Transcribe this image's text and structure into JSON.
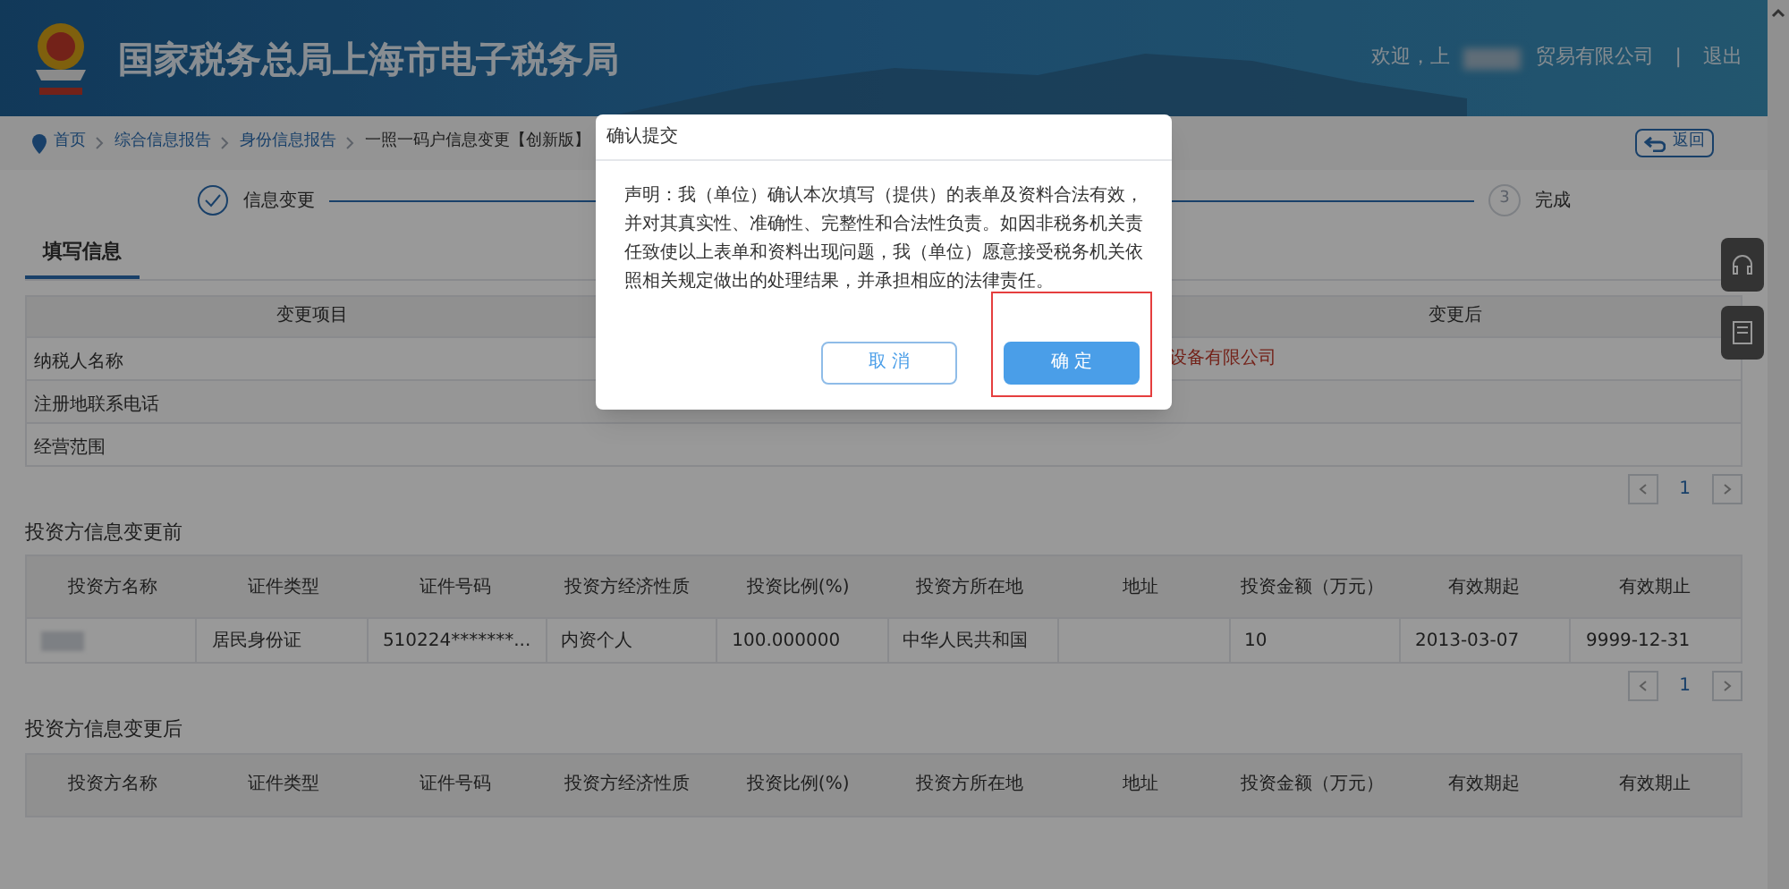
{
  "header": {
    "title": "国家税务总局上海市电子税务局",
    "welcome_prefix": "欢迎，上",
    "welcome_suffix": "贸易有限公司",
    "separator": "|",
    "logout": "退出"
  },
  "breadcrumb": [
    {
      "label": "首页"
    },
    {
      "label": "综合信息报告"
    },
    {
      "label": "身份信息报告"
    },
    {
      "label": "一照一码户信息变更【创新版】"
    }
  ],
  "back_button": "返回",
  "steps": [
    {
      "kind": "done",
      "label": "信息变更"
    },
    {
      "kind": "pending",
      "number": "3",
      "label": "完成"
    }
  ],
  "tabs": [
    {
      "label": "填写信息",
      "selected": true
    }
  ],
  "change_table": {
    "columns": [
      {
        "label": "变更项目"
      },
      {
        "label": "变更后"
      }
    ],
    "rows": [
      {
        "item": "纳税人名称",
        "after": "设备有限公司"
      },
      {
        "item": "注册地联系电话"
      },
      {
        "item": "经营范围"
      }
    ]
  },
  "pagination_1": {
    "page": "1"
  },
  "investors_before": {
    "title": "投资方信息变更前",
    "columns": [
      "投资方名称",
      "证件类型",
      "证件号码",
      "投资方经济性质",
      "投资比例(%)",
      "投资方所在地",
      "地址",
      "投资金额（万元）",
      "有效期起",
      "有效期止"
    ],
    "rows": [
      {
        "name_redacted": true,
        "cells": [
          "",
          "居民身份证",
          "510224*******...",
          "内资个人",
          "100.000000",
          "中华人民共和国",
          "",
          "10",
          "2013-03-07",
          "9999-12-31"
        ]
      }
    ]
  },
  "pagination_2": {
    "page": "1"
  },
  "investors_after": {
    "title": "投资方信息变更后",
    "columns": [
      "投资方名称",
      "证件类型",
      "证件号码",
      "投资方经济性质",
      "投资比例(%)",
      "投资方所在地",
      "地址",
      "投资金额（万元）",
      "有效期起",
      "有效期止"
    ]
  },
  "dialog": {
    "title": "确认提交",
    "body": "声明：我（单位）确认本次填写（提供）的表单及资料合法有效，并对其真实性、准确性、完整性和合法性负责。如因非税务机关责任致使以上表单和资料出现问题，我（单位）愿意接受税务机关依照相关规定做出的处理结果，并承担相应的法律责任。",
    "buttons": [
      {
        "label": "取 消",
        "kind": "secondary",
        "highlighted": false
      },
      {
        "label": "确 定",
        "kind": "primary",
        "highlighted": true
      }
    ]
  }
}
